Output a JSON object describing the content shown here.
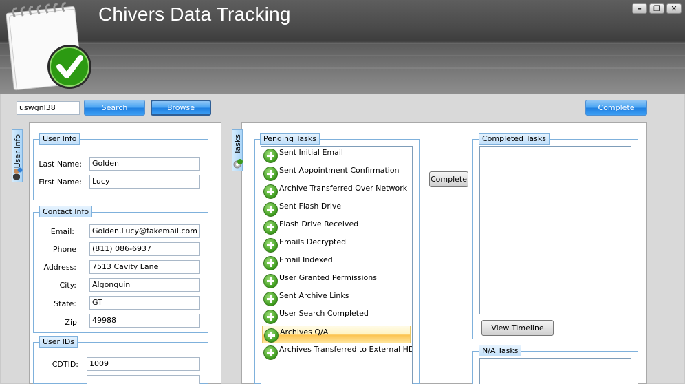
{
  "app": {
    "title": "Chivers Data Tracking"
  },
  "window_controls": {
    "minimize": "–",
    "restore": "❐",
    "close": "✕"
  },
  "toolbar": {
    "search_value": "uswgnl38",
    "search_label": "Search",
    "browse_label": "Browse",
    "complete_label": "Complete"
  },
  "user_panel": {
    "tab_label": "User Info",
    "user_info": {
      "title": "User Info",
      "last_name_label": "Last Name:",
      "last_name": "Golden",
      "first_name_label": "First Name:",
      "first_name": "Lucy"
    },
    "contact_info": {
      "title": "Contact Info",
      "email_label": "Email:",
      "email": "Golden.Lucy@fakemail.com",
      "phone_label": "Phone",
      "phone": "(811) 086-6937",
      "address_label": "Address:",
      "address": "7513 Cavity Lane",
      "city_label": "City:",
      "city": "Algonquin",
      "state_label": "State:",
      "state": "GT",
      "zip_label": "Zip",
      "zip": "49988"
    },
    "user_ids": {
      "title": "User IDs",
      "cdtid_label": "CDTID:",
      "cdtid": "1009"
    }
  },
  "tasks_panel": {
    "tab_label": "Tasks",
    "pending_title": "Pending Tasks",
    "pending_tasks": [
      "Sent Initial Email",
      "Sent Appointment Confirmation",
      "Archive Transferred Over Network",
      "Sent Flash Drive",
      "Flash Drive Received",
      "Emails Decrypted",
      "Email Indexed",
      "User Granted Permissions",
      "Sent Archive Links",
      "User Search Completed",
      "Archives Q/A",
      "Archives Transferred to External HD"
    ],
    "selected_task": "Archives Q/A",
    "complete_label": "Complete",
    "completed_title": "Completed Tasks",
    "view_timeline_label": "View Timeline",
    "na_title": "N/A Tasks"
  },
  "colors": {
    "accent": "#3ea0f4",
    "header": "#4a4a4a",
    "highlight": "#fcc24d",
    "add_icon": "#3c9a1c"
  }
}
